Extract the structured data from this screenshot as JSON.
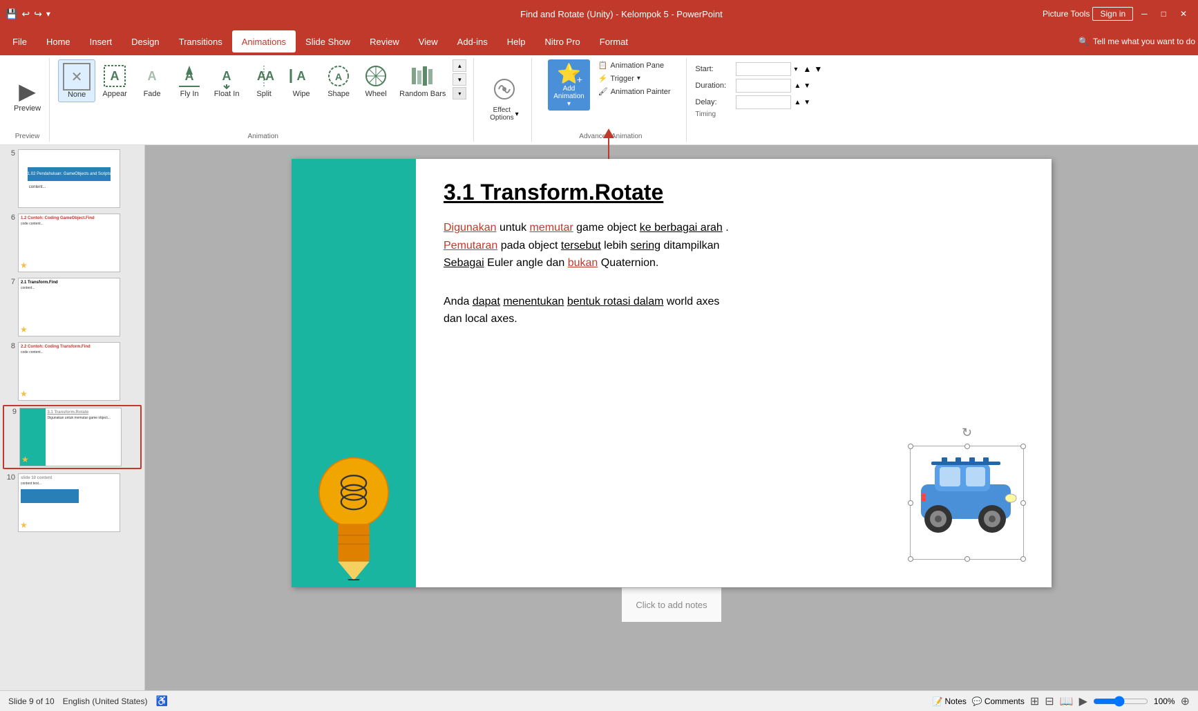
{
  "titlebar": {
    "title": "Find and Rotate (Unity) - Kelompok 5 - PowerPoint",
    "picture_tools": "Picture Tools",
    "sign_in": "Sign in"
  },
  "menubar": {
    "items": [
      "File",
      "Home",
      "Insert",
      "Design",
      "Transitions",
      "Animations",
      "Slide Show",
      "Review",
      "View",
      "Add-ins",
      "Help",
      "Nitro Pro",
      "Format"
    ],
    "active": "Animations",
    "tell_me": "Tell me what you want to do"
  },
  "ribbon": {
    "preview_label": "Preview",
    "animation_label": "Animation",
    "none_label": "None",
    "appear_label": "Appear",
    "fade_label": "Fade",
    "fly_in_label": "Fly In",
    "float_in_label": "Float In",
    "split_label": "Split",
    "wipe_label": "Wipe",
    "shape_label": "Shape",
    "wheel_label": "Wheel",
    "random_bars_label": "Random Bars",
    "effect_options_label": "Effect Options",
    "add_animation_label": "Add Animation",
    "advanced_animation_label": "Advanced Animation",
    "animation_pane_label": "Animation Pane",
    "trigger_label": "Trigger",
    "animation_painter_label": "Animation Painter",
    "timing_label": "Timing",
    "start_label": "Start:",
    "duration_label": "Duration:",
    "delay_label": "Delay:"
  },
  "slides": [
    {
      "num": "5",
      "active": false,
      "has_star": false
    },
    {
      "num": "6",
      "active": false,
      "has_star": true
    },
    {
      "num": "7",
      "active": false,
      "has_star": true
    },
    {
      "num": "8",
      "active": false,
      "has_star": true
    },
    {
      "num": "9",
      "active": true,
      "has_star": true
    },
    {
      "num": "10",
      "active": false,
      "has_star": true
    }
  ],
  "slide": {
    "title": "3.1 Transform.Rotate",
    "body1": "Digunakan untuk memutar game object ke berbagai arah. Pemutaran pada object tersebut lebih sering ditampilkan Sebagai Euler angle dan bukan Quaternion.",
    "body2": "Anda dapat menentukan bentuk rotasi dalam world axes dan local axes."
  },
  "bottombar": {
    "slide_info": "Slide 9 of 10",
    "language": "English (United States)",
    "notes_label": "Notes",
    "comments_label": "Comments",
    "click_to_add_notes": "Click to add notes"
  }
}
